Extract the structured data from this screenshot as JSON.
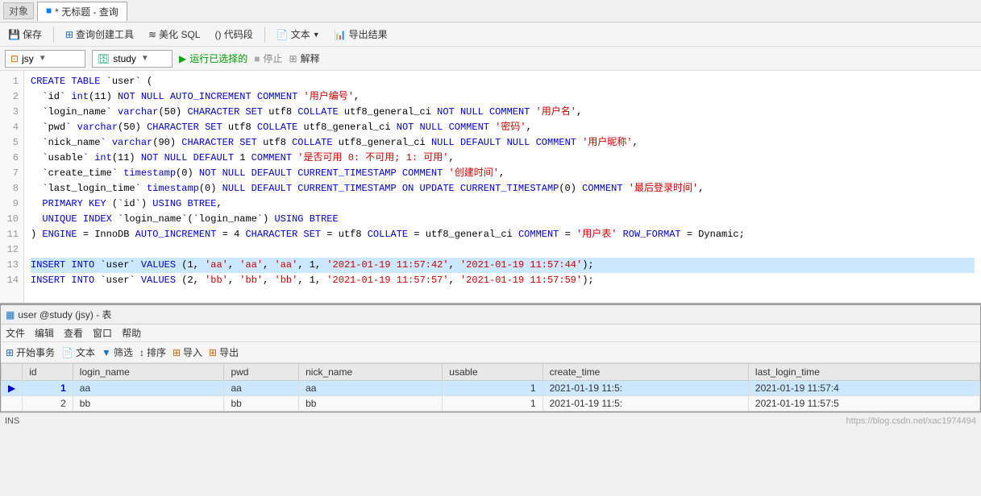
{
  "titleBar": {
    "objectTabLabel": "对象",
    "queryTabLabel": "* 无标题 - 查询",
    "queryIcon": "■"
  },
  "toolbar": {
    "saveLabel": "保存",
    "queryBuilderLabel": "查询创建工具",
    "beautifySqlLabel": "美化 SQL",
    "codeSnippetLabel": "() 代码段",
    "textLabel": "文本",
    "exportResultLabel": "导出结果"
  },
  "connBar": {
    "serverName": "jsy",
    "databaseName": "study",
    "runLabel": "运行已选择的",
    "stopLabel": "停止",
    "explainLabel": "解释"
  },
  "codeLines": [
    {
      "num": 1,
      "content": "CREATE TABLE `user` (",
      "type": "sql"
    },
    {
      "num": 2,
      "content": "  `id` int(11) NOT NULL AUTO_INCREMENT COMMENT '用户编号',",
      "type": "sql"
    },
    {
      "num": 3,
      "content": "  `login_name` varchar(50) CHARACTER SET utf8 COLLATE utf8_general_ci NOT NULL COMMENT '用户名',",
      "type": "sql"
    },
    {
      "num": 4,
      "content": "  `pwd` varchar(50) CHARACTER SET utf8 COLLATE utf8_general_ci NOT NULL COMMENT '密码',",
      "type": "sql"
    },
    {
      "num": 5,
      "content": "  `nick_name` varchar(90) CHARACTER SET utf8 COLLATE utf8_general_ci NULL DEFAULT NULL COMMENT '用户昵称',",
      "type": "sql"
    },
    {
      "num": 6,
      "content": "  `usable` int(11) NOT NULL DEFAULT 1 COMMENT '是否可用 0: 不可用; 1: 可用',",
      "type": "sql"
    },
    {
      "num": 7,
      "content": "  `create_time` timestamp(0) NOT NULL DEFAULT CURRENT_TIMESTAMP COMMENT '创建时间',",
      "type": "sql"
    },
    {
      "num": 8,
      "content": "  `last_login_time` timestamp(0) NULL DEFAULT CURRENT_TIMESTAMP ON UPDATE CURRENT_TIMESTAMP(0) COMMENT '最后登录时间',",
      "type": "sql"
    },
    {
      "num": 9,
      "content": "  PRIMARY KEY (`id`) USING BTREE,",
      "type": "sql"
    },
    {
      "num": 10,
      "content": "  UNIQUE INDEX `login_name`(`login_name`) USING BTREE",
      "type": "sql"
    },
    {
      "num": 11,
      "content": ") ENGINE = InnoDB AUTO_INCREMENT = 4 CHARACTER SET = utf8 COLLATE = utf8_general_ci COMMENT = '用户表' ROW_FORMAT = Dynamic;",
      "type": "sql"
    },
    {
      "num": 12,
      "content": "",
      "type": "blank"
    },
    {
      "num": 13,
      "content": "INSERT INTO `user` VALUES (1, 'aa', 'aa', 'aa', 1, '2021-01-19 11:57:42', '2021-01-19 11:57:44');",
      "type": "insert",
      "highlight": true
    },
    {
      "num": 14,
      "content": "INSERT INTO `user` VALUES (2, 'bb', 'bb', 'bb', 1, '2021-01-19 11:57:57', '2021-01-19 11:57:59');",
      "type": "insert"
    }
  ],
  "tableWindow": {
    "title": "user @study (jsy) - 表",
    "menuItems": [
      "文件",
      "编辑",
      "查看",
      "窗口",
      "帮助"
    ],
    "toolbarItems": [
      "开始事务",
      "文本",
      "筛选",
      "排序",
      "导入",
      "导出"
    ],
    "columns": [
      "id",
      "login_name",
      "pwd",
      "nick_name",
      "usable",
      "create_time",
      "last_login_time"
    ],
    "rows": [
      {
        "id": "1",
        "login_name": "aa",
        "pwd": "aa",
        "nick_name": "aa",
        "usable": "1",
        "create_time": "2021-01-19 11:5:",
        "last_login_time": "2021-01-19 11:57:4",
        "selected": true
      },
      {
        "id": "2",
        "login_name": "bb",
        "pwd": "bb",
        "nick_name": "bb",
        "usable": "1",
        "create_time": "2021-01-19 11:5:",
        "last_login_time": "2021-01-19 11:57:5",
        "selected": false
      }
    ]
  },
  "statusBar": {
    "text": "INS"
  },
  "watermark": "https://blog.csdn.net/xac1974494"
}
